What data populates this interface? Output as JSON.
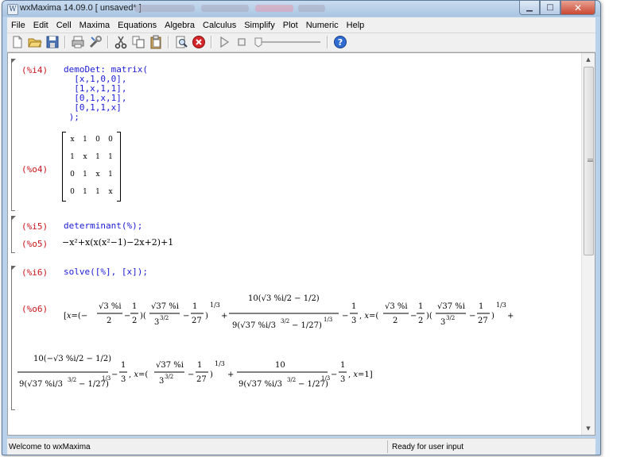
{
  "window": {
    "title": "wxMaxima 14.09.0 [ unsaved* ]"
  },
  "menubar": [
    "File",
    "Edit",
    "Cell",
    "Maxima",
    "Equations",
    "Algebra",
    "Calculus",
    "Simplify",
    "Plot",
    "Numeric",
    "Help"
  ],
  "toolbar": {
    "icons": [
      "new-document-icon",
      "open-folder-icon",
      "save-icon",
      "cut-icon",
      "copy-icon",
      "paste-icon",
      "print-icon",
      "preferences-icon",
      "find-icon",
      "interrupt-icon",
      "play-icon",
      "stop-icon",
      "animation-slider",
      "help-icon"
    ]
  },
  "cells": {
    "c1": {
      "in_label": "(%i4)",
      "input_lines": [
        "demoDet: matrix(",
        "  [x,1,0,0],",
        "  [1,x,1,1],",
        "  [0,1,x,1],",
        "  [0,1,1,x]",
        " );"
      ],
      "out_label": "(%o4)",
      "matrix": [
        [
          "x",
          "1",
          "0",
          "0"
        ],
        [
          "1",
          "x",
          "1",
          "1"
        ],
        [
          "0",
          "1",
          "x",
          "1"
        ],
        [
          "0",
          "1",
          "1",
          "x"
        ]
      ]
    },
    "c2": {
      "in_label": "(%i5)",
      "input": "determinant(%);",
      "out_label": "(%o5)",
      "output_text": "−x²+x(x(x²−1)−2x+2)+1"
    },
    "c3": {
      "in_label": "(%i6)",
      "input": "solve([%], [x]);",
      "out_label": "(%o6)",
      "row1_text": "[x=(−√3 %i/2 − 1/2)(√37 %i/3^(3/2) − 1/27)^(1/3) + 10(√3 %i/2 − 1/2)/(9(√37 %i/3^(3/2) − 1/27)^(1/3)) − 1/3, x=(√3 %i/2 − 1/2)(√37 %i/3^(3/2) − 1/27)^(1/3) +",
      "row2_text": "10(−√3 %i/2 − 1/2)/(9(√37 %i/3^(3/2) − 1/27)^(1/3)) − 1/3, x=(√37 %i/3^(3/2) − 1/27)^(1/3) + 10/(9(√37 %i/3^(3/2) − 1/27)^(1/3)) − 1/3, x=1]"
    }
  },
  "status": {
    "left": "Welcome to wxMaxima",
    "right": "Ready for user input"
  },
  "colors": {
    "label": "#c8161d",
    "input": "#1a1ad6",
    "titlebar": "#b9d1ea",
    "close": "#c94731"
  }
}
